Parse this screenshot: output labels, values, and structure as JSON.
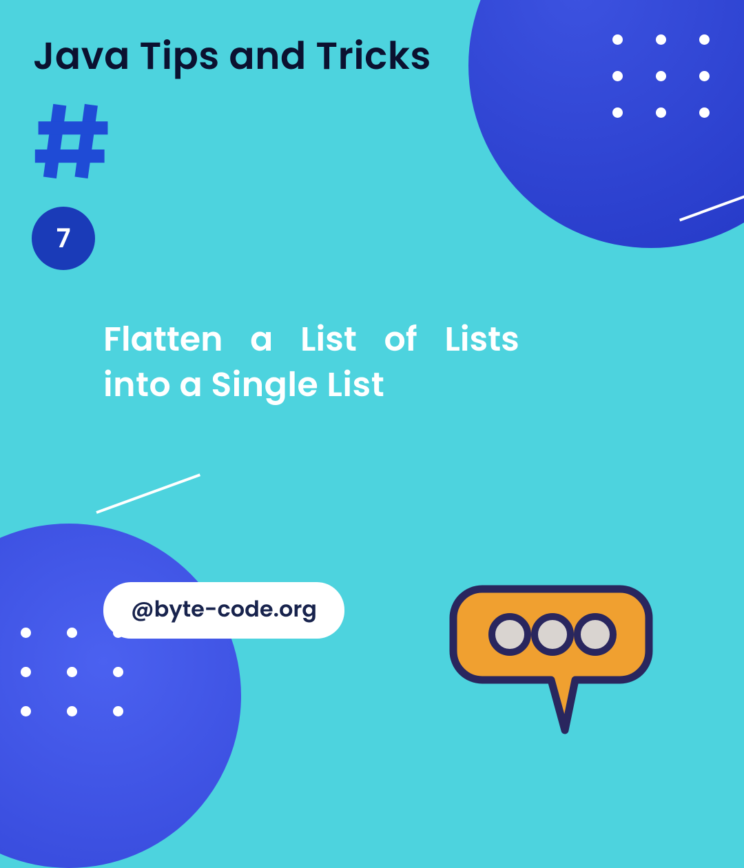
{
  "title": "Java Tips and Tricks",
  "badge_number": "7",
  "headline_line1": "Flatten a List of Lists",
  "headline_line2": "into a Single List",
  "handle": "@byte-code.org",
  "colors": {
    "background": "#4dd3de",
    "accent_blue": "#2236c4",
    "badge_blue": "#1a3bb8",
    "speech_orange": "#f0a030",
    "speech_stroke": "#29265e"
  },
  "icons": {
    "hash": "hash-icon",
    "speech": "speech-bubble-icon"
  }
}
